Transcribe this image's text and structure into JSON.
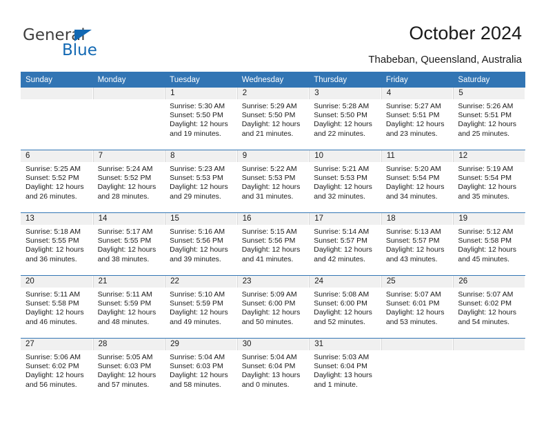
{
  "branding": {
    "logo_text_primary": "General",
    "logo_text_secondary": "Blue",
    "logo_accent_color": "#1268b3"
  },
  "header": {
    "title": "October 2024",
    "subtitle": "Thabeban, Queensland, Australia"
  },
  "theme": {
    "header_blue": "#3275b4",
    "daynum_band": "#f0f0f0",
    "text": "#1a1a1a"
  },
  "calendar": {
    "weekday_headers": [
      "Sunday",
      "Monday",
      "Tuesday",
      "Wednesday",
      "Thursday",
      "Friday",
      "Saturday"
    ],
    "weeks": [
      [
        {
          "day": "",
          "empty": true,
          "sunrise": "",
          "sunset": "",
          "daylight_1": "",
          "daylight_2": ""
        },
        {
          "day": "",
          "empty": true,
          "sunrise": "",
          "sunset": "",
          "daylight_1": "",
          "daylight_2": ""
        },
        {
          "day": "1",
          "sunrise": "Sunrise: 5:30 AM",
          "sunset": "Sunset: 5:50 PM",
          "daylight_1": "Daylight: 12 hours",
          "daylight_2": "and 19 minutes."
        },
        {
          "day": "2",
          "sunrise": "Sunrise: 5:29 AM",
          "sunset": "Sunset: 5:50 PM",
          "daylight_1": "Daylight: 12 hours",
          "daylight_2": "and 21 minutes."
        },
        {
          "day": "3",
          "sunrise": "Sunrise: 5:28 AM",
          "sunset": "Sunset: 5:50 PM",
          "daylight_1": "Daylight: 12 hours",
          "daylight_2": "and 22 minutes."
        },
        {
          "day": "4",
          "sunrise": "Sunrise: 5:27 AM",
          "sunset": "Sunset: 5:51 PM",
          "daylight_1": "Daylight: 12 hours",
          "daylight_2": "and 23 minutes."
        },
        {
          "day": "5",
          "sunrise": "Sunrise: 5:26 AM",
          "sunset": "Sunset: 5:51 PM",
          "daylight_1": "Daylight: 12 hours",
          "daylight_2": "and 25 minutes."
        }
      ],
      [
        {
          "day": "6",
          "sunrise": "Sunrise: 5:25 AM",
          "sunset": "Sunset: 5:52 PM",
          "daylight_1": "Daylight: 12 hours",
          "daylight_2": "and 26 minutes."
        },
        {
          "day": "7",
          "sunrise": "Sunrise: 5:24 AM",
          "sunset": "Sunset: 5:52 PM",
          "daylight_1": "Daylight: 12 hours",
          "daylight_2": "and 28 minutes."
        },
        {
          "day": "8",
          "sunrise": "Sunrise: 5:23 AM",
          "sunset": "Sunset: 5:53 PM",
          "daylight_1": "Daylight: 12 hours",
          "daylight_2": "and 29 minutes."
        },
        {
          "day": "9",
          "sunrise": "Sunrise: 5:22 AM",
          "sunset": "Sunset: 5:53 PM",
          "daylight_1": "Daylight: 12 hours",
          "daylight_2": "and 31 minutes."
        },
        {
          "day": "10",
          "sunrise": "Sunrise: 5:21 AM",
          "sunset": "Sunset: 5:53 PM",
          "daylight_1": "Daylight: 12 hours",
          "daylight_2": "and 32 minutes."
        },
        {
          "day": "11",
          "sunrise": "Sunrise: 5:20 AM",
          "sunset": "Sunset: 5:54 PM",
          "daylight_1": "Daylight: 12 hours",
          "daylight_2": "and 34 minutes."
        },
        {
          "day": "12",
          "sunrise": "Sunrise: 5:19 AM",
          "sunset": "Sunset: 5:54 PM",
          "daylight_1": "Daylight: 12 hours",
          "daylight_2": "and 35 minutes."
        }
      ],
      [
        {
          "day": "13",
          "sunrise": "Sunrise: 5:18 AM",
          "sunset": "Sunset: 5:55 PM",
          "daylight_1": "Daylight: 12 hours",
          "daylight_2": "and 36 minutes."
        },
        {
          "day": "14",
          "sunrise": "Sunrise: 5:17 AM",
          "sunset": "Sunset: 5:55 PM",
          "daylight_1": "Daylight: 12 hours",
          "daylight_2": "and 38 minutes."
        },
        {
          "day": "15",
          "sunrise": "Sunrise: 5:16 AM",
          "sunset": "Sunset: 5:56 PM",
          "daylight_1": "Daylight: 12 hours",
          "daylight_2": "and 39 minutes."
        },
        {
          "day": "16",
          "sunrise": "Sunrise: 5:15 AM",
          "sunset": "Sunset: 5:56 PM",
          "daylight_1": "Daylight: 12 hours",
          "daylight_2": "and 41 minutes."
        },
        {
          "day": "17",
          "sunrise": "Sunrise: 5:14 AM",
          "sunset": "Sunset: 5:57 PM",
          "daylight_1": "Daylight: 12 hours",
          "daylight_2": "and 42 minutes."
        },
        {
          "day": "18",
          "sunrise": "Sunrise: 5:13 AM",
          "sunset": "Sunset: 5:57 PM",
          "daylight_1": "Daylight: 12 hours",
          "daylight_2": "and 43 minutes."
        },
        {
          "day": "19",
          "sunrise": "Sunrise: 5:12 AM",
          "sunset": "Sunset: 5:58 PM",
          "daylight_1": "Daylight: 12 hours",
          "daylight_2": "and 45 minutes."
        }
      ],
      [
        {
          "day": "20",
          "sunrise": "Sunrise: 5:11 AM",
          "sunset": "Sunset: 5:58 PM",
          "daylight_1": "Daylight: 12 hours",
          "daylight_2": "and 46 minutes."
        },
        {
          "day": "21",
          "sunrise": "Sunrise: 5:11 AM",
          "sunset": "Sunset: 5:59 PM",
          "daylight_1": "Daylight: 12 hours",
          "daylight_2": "and 48 minutes."
        },
        {
          "day": "22",
          "sunrise": "Sunrise: 5:10 AM",
          "sunset": "Sunset: 5:59 PM",
          "daylight_1": "Daylight: 12 hours",
          "daylight_2": "and 49 minutes."
        },
        {
          "day": "23",
          "sunrise": "Sunrise: 5:09 AM",
          "sunset": "Sunset: 6:00 PM",
          "daylight_1": "Daylight: 12 hours",
          "daylight_2": "and 50 minutes."
        },
        {
          "day": "24",
          "sunrise": "Sunrise: 5:08 AM",
          "sunset": "Sunset: 6:00 PM",
          "daylight_1": "Daylight: 12 hours",
          "daylight_2": "and 52 minutes."
        },
        {
          "day": "25",
          "sunrise": "Sunrise: 5:07 AM",
          "sunset": "Sunset: 6:01 PM",
          "daylight_1": "Daylight: 12 hours",
          "daylight_2": "and 53 minutes."
        },
        {
          "day": "26",
          "sunrise": "Sunrise: 5:07 AM",
          "sunset": "Sunset: 6:02 PM",
          "daylight_1": "Daylight: 12 hours",
          "daylight_2": "and 54 minutes."
        }
      ],
      [
        {
          "day": "27",
          "sunrise": "Sunrise: 5:06 AM",
          "sunset": "Sunset: 6:02 PM",
          "daylight_1": "Daylight: 12 hours",
          "daylight_2": "and 56 minutes."
        },
        {
          "day": "28",
          "sunrise": "Sunrise: 5:05 AM",
          "sunset": "Sunset: 6:03 PM",
          "daylight_1": "Daylight: 12 hours",
          "daylight_2": "and 57 minutes."
        },
        {
          "day": "29",
          "sunrise": "Sunrise: 5:04 AM",
          "sunset": "Sunset: 6:03 PM",
          "daylight_1": "Daylight: 12 hours",
          "daylight_2": "and 58 minutes."
        },
        {
          "day": "30",
          "sunrise": "Sunrise: 5:04 AM",
          "sunset": "Sunset: 6:04 PM",
          "daylight_1": "Daylight: 13 hours",
          "daylight_2": "and 0 minutes."
        },
        {
          "day": "31",
          "sunrise": "Sunrise: 5:03 AM",
          "sunset": "Sunset: 6:04 PM",
          "daylight_1": "Daylight: 13 hours",
          "daylight_2": "and 1 minute."
        },
        {
          "day": "",
          "empty": true,
          "sunrise": "",
          "sunset": "",
          "daylight_1": "",
          "daylight_2": ""
        },
        {
          "day": "",
          "empty": true,
          "sunrise": "",
          "sunset": "",
          "daylight_1": "",
          "daylight_2": ""
        }
      ]
    ]
  }
}
